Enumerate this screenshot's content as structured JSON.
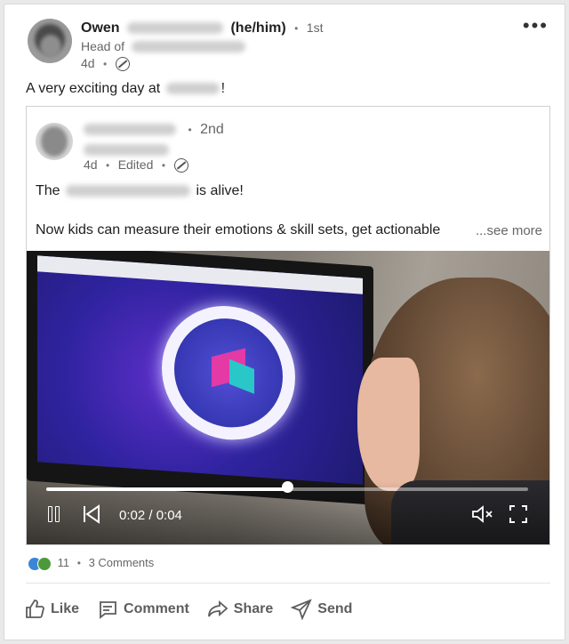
{
  "post": {
    "author": {
      "name": "Owen",
      "pronouns": "(he/him)",
      "degree": "1st",
      "headline": "Head of",
      "age": "4d"
    },
    "text_prefix": "A very exciting day at",
    "text_suffix": "!",
    "menu": "•••"
  },
  "shared": {
    "author": {
      "degree": "2nd",
      "age": "4d",
      "edited": "Edited"
    },
    "line1_prefix": "The",
    "line1_suffix": "is alive!",
    "line2": "Now kids can measure their emotions & skill sets, get actionable",
    "see_more": "...see more"
  },
  "video": {
    "time": "0:02 / 0:04",
    "progress": 0.5,
    "muted_icon": "volume-muted-icon",
    "fullscreen_icon": "fullscreen-icon"
  },
  "social": {
    "reactions": "11",
    "comments": "3 Comments"
  },
  "actions": {
    "like": "Like",
    "comment": "Comment",
    "share": "Share",
    "send": "Send"
  },
  "colors": {
    "like_blue": "#3b86d6",
    "celebrate_green": "#4a9a3a"
  }
}
